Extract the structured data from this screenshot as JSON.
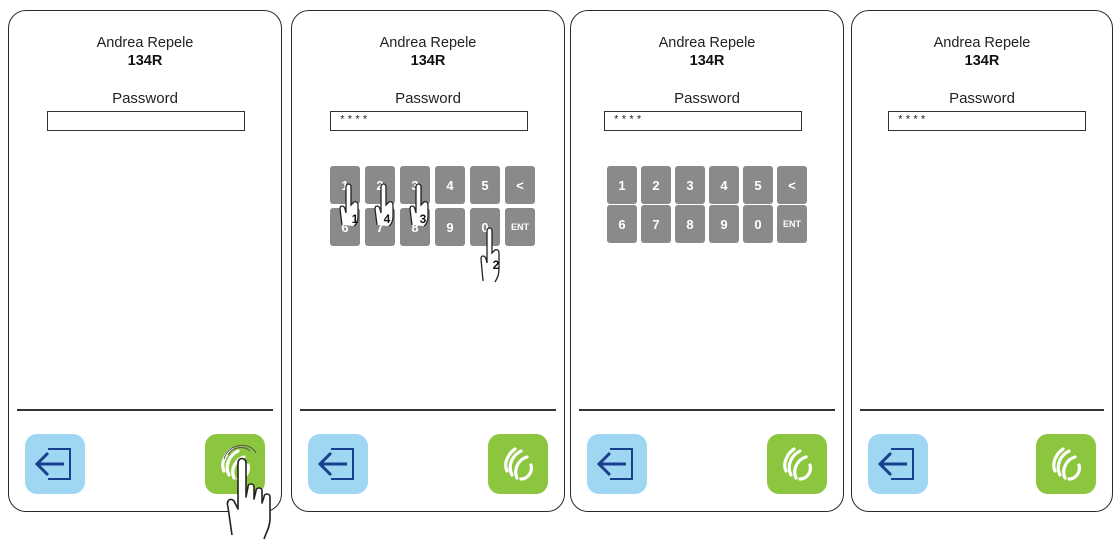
{
  "screens": [
    {
      "user_name": "Andrea Repele",
      "user_code": "134R",
      "password_label": "Password",
      "password_value": ""
    },
    {
      "user_name": "Andrea Repele",
      "user_code": "134R",
      "password_label": "Password",
      "password_value": "****"
    },
    {
      "user_name": "Andrea Repele",
      "user_code": "134R",
      "password_label": "Password",
      "password_value": "****"
    },
    {
      "user_name": "Andrea Repele",
      "user_code": "134R",
      "password_label": "Password",
      "password_value": "****"
    }
  ],
  "keypad": {
    "row1": [
      "1",
      "2",
      "3",
      "4",
      "5",
      "<"
    ],
    "row2": [
      "6",
      "7",
      "8",
      "9",
      "0",
      "ENT"
    ]
  },
  "tap_steps": [
    "1",
    "2",
    "3",
    "4"
  ],
  "icons": {
    "back": "back-arrow-icon",
    "confirm": "hand-wave-icon"
  },
  "colors": {
    "back_button": "#9fd6f2",
    "confirm_button": "#8cc63f",
    "key": "#8a8a8a"
  }
}
